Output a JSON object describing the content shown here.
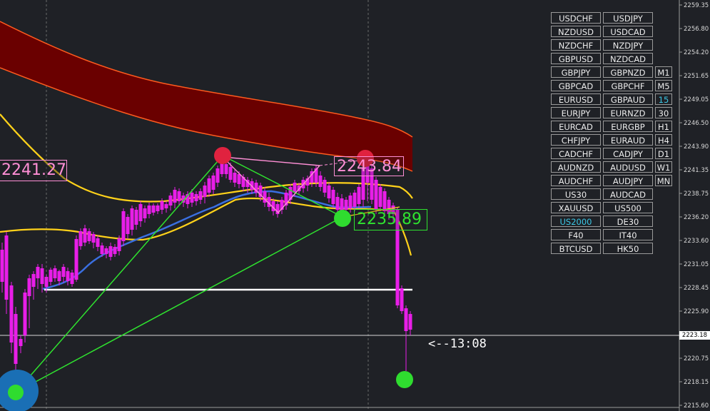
{
  "price_axis": {
    "labels": [
      "2259.35",
      "2256.80",
      "2254.20",
      "2251.65",
      "2249.05",
      "2246.50",
      "2243.90",
      "2241.35",
      "2238.75",
      "2236.20",
      "2233.60",
      "2231.05",
      "2228.45",
      "2225.90",
      "2223.18",
      "2220.75",
      "2218.15",
      "2215.60"
    ]
  },
  "current_price": "2223.18",
  "countdown": "<--13:08",
  "price_tags": {
    "left": "2241.27",
    "top": "2243.84",
    "low": "2235.89"
  },
  "symbol_panel": {
    "rows": [
      [
        "USDCHF",
        "USDJPY"
      ],
      [
        "NZDUSD",
        "USDCAD"
      ],
      [
        "NZDCHF",
        "NZDJPY"
      ],
      [
        "GBPUSD",
        "NZDCAD"
      ],
      [
        "GBPJPY",
        "GBPNZD"
      ],
      [
        "GBPCAD",
        "GBPCHF"
      ],
      [
        "EURUSD",
        "GBPAUD"
      ],
      [
        "EURJPY",
        "EURNZD"
      ],
      [
        "EURCAD",
        "EURGBP"
      ],
      [
        "CHFJPY",
        "EURAUD"
      ],
      [
        "CADCHF",
        "CADJPY"
      ],
      [
        "AUDNZD",
        "AUDUSD"
      ],
      [
        "AUDCHF",
        "AUDJPY"
      ],
      [
        "US30",
        "AUDCAD"
      ],
      [
        "XAUUSD",
        "US500"
      ],
      [
        "US2000",
        "DE30"
      ],
      [
        "F40",
        "IT40"
      ],
      [
        "BTCUSD",
        "HK50"
      ]
    ],
    "active_symbol": "US2000",
    "timeframes": [
      "M1",
      "M5",
      "15",
      "30",
      "H1",
      "H4",
      "D1",
      "W1",
      "MN"
    ],
    "active_timeframe": "15"
  },
  "colors": {
    "background": "#1f2126",
    "candle": "#e81ee8",
    "blue_ma": "#3a6fe0",
    "yellow_ma": "#ffd21a",
    "band_fill": "#6a0000",
    "band_edge": "#ff5a1e",
    "green_line": "#2fe32f",
    "pink_line": "#ff8fd6",
    "red_dot": "#e0223f",
    "green_dot": "#2fdc2f",
    "blue_dot": "#1a6fb5",
    "active_button": "#3cc8e6"
  }
}
